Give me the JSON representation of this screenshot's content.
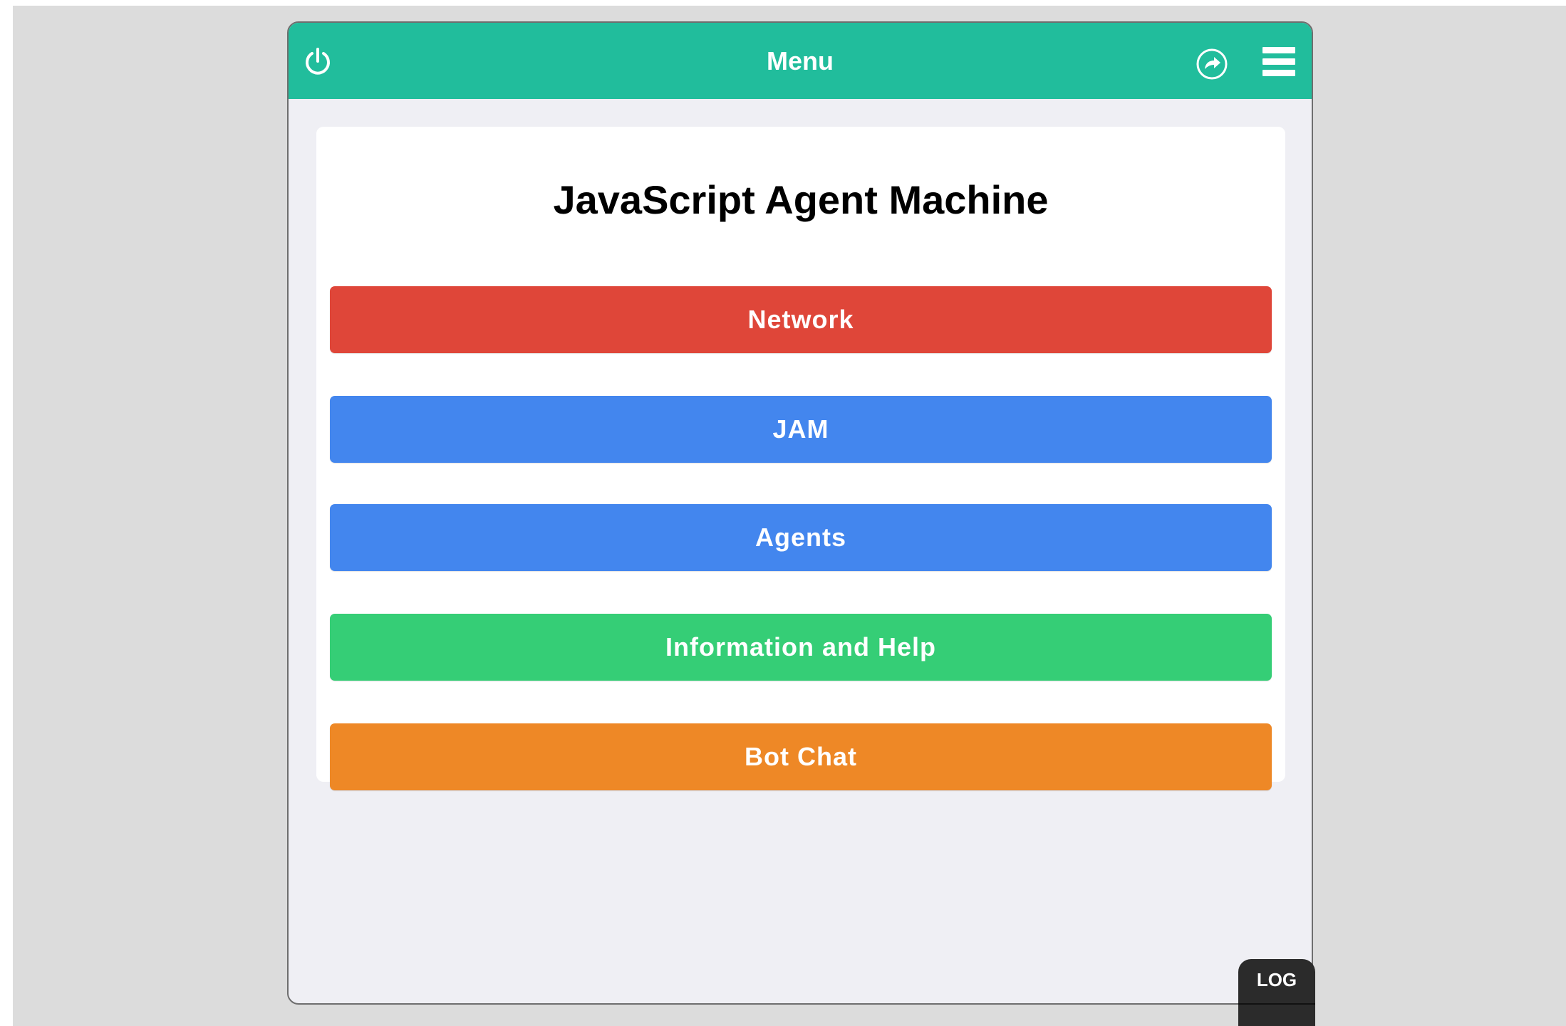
{
  "appbar": {
    "title": "Menu",
    "color": "#21bd9c",
    "left_icon": "power-icon",
    "right_icons": [
      "share-icon",
      "hamburger-menu-icon"
    ]
  },
  "card": {
    "title": "JavaScript Agent Machine"
  },
  "menu_buttons": [
    {
      "label": "Network",
      "color": "#df4639"
    },
    {
      "label": "JAM",
      "color": "#4386ee"
    },
    {
      "label": "Agents",
      "color": "#4386ee"
    },
    {
      "label": "Information and Help",
      "color": "#35ce76"
    },
    {
      "label": "Bot Chat",
      "color": "#ee8826"
    }
  ],
  "log_tab": {
    "label": "LOG"
  }
}
